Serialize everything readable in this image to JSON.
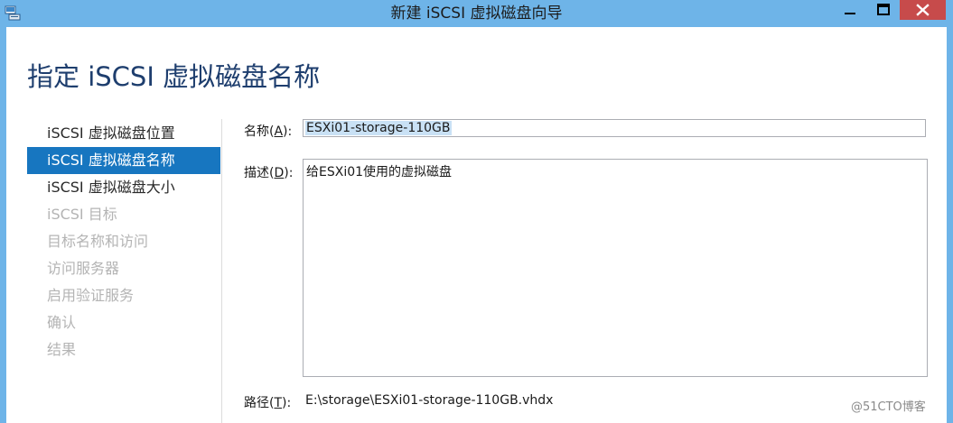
{
  "window": {
    "title": "新建 iSCSI 虚拟磁盘向导",
    "controls": {
      "minimize": "minimize",
      "maximize": "maximize",
      "close": "close"
    },
    "accent_color": "#6eb4e8",
    "close_color": "#c74b4b"
  },
  "page": {
    "heading": "指定 iSCSI 虚拟磁盘名称"
  },
  "nav": {
    "items": [
      {
        "label": "iSCSI 虚拟磁盘位置",
        "state": "normal"
      },
      {
        "label": "iSCSI 虚拟磁盘名称",
        "state": "active"
      },
      {
        "label": "iSCSI 虚拟磁盘大小",
        "state": "normal"
      },
      {
        "label": "iSCSI 目标",
        "state": "disabled"
      },
      {
        "label": "目标名称和访问",
        "state": "disabled"
      },
      {
        "label": "访问服务器",
        "state": "disabled"
      },
      {
        "label": "启用验证服务",
        "state": "disabled"
      },
      {
        "label": "确认",
        "state": "disabled"
      },
      {
        "label": "结果",
        "state": "disabled"
      }
    ],
    "active_color": "#1776c0"
  },
  "form": {
    "name_label": "名称(",
    "name_key": "A",
    "name_label_end": "):",
    "name_value": "ESXi01-storage-110GB",
    "desc_label": "描述(",
    "desc_key": "D",
    "desc_label_end": "):",
    "desc_value": "给ESXi01使用的虚拟磁盘",
    "path_label": "路径(",
    "path_key": "T",
    "path_label_end": "):",
    "path_value": "E:\\storage\\ESXi01-storage-110GB.vhdx"
  },
  "watermark": "@51CTO博客"
}
